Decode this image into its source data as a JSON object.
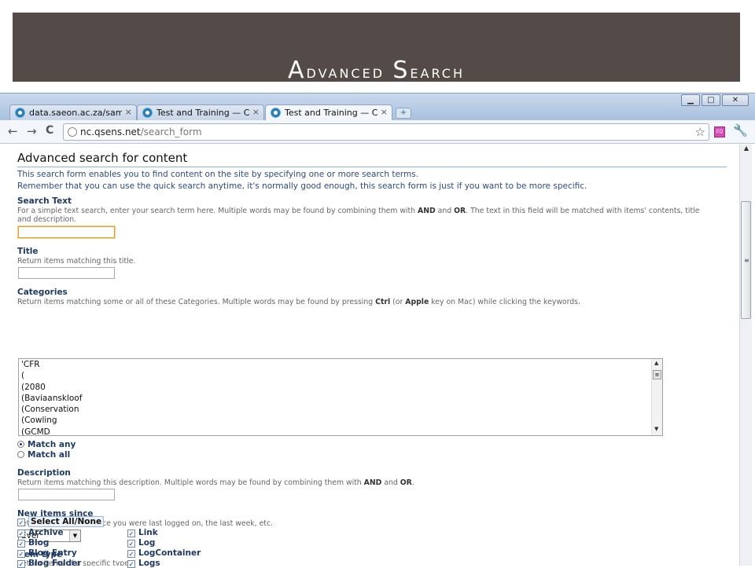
{
  "slide": {
    "title_first": "A",
    "title_rest1": "dvanced ",
    "title_second": "S",
    "title_rest2": "earch"
  },
  "browser": {
    "tabs": [
      {
        "label": "data.saeon.ac.za/sample-...",
        "close": "×"
      },
      {
        "label": "Test and Training — CoGIS",
        "close": "×"
      },
      {
        "label": "Test and Training — CoGIS",
        "close": "×"
      }
    ],
    "new_tab": "+",
    "window_controls": {
      "minimize": "▁",
      "maximize": "□",
      "close": "✕"
    },
    "nav": {
      "back": "←",
      "forward": "→",
      "reload": "C"
    },
    "url_host": "nc.qsens.net",
    "url_path": "/search_form",
    "star": "☆",
    "ext_label": "EQ",
    "wrench": "🔧"
  },
  "page": {
    "title": "Advanced search for content",
    "intro_1": "This search form enables you to find content on the site by specifying one or more search terms.",
    "intro_2": "Remember that you can use the quick search anytime, it's normally good enough, this search form is just if you want to be more specific.",
    "search_text": {
      "label": "Search Text",
      "help_a": "For a simple text search, enter your search term here. Multiple words may be found by combining them with ",
      "help_and": "AND",
      "help_b": " and ",
      "help_or": "OR",
      "help_c": ". The text in this field will be matched with items' contents, title",
      "help_d": "and description.",
      "value": ""
    },
    "title_field": {
      "label": "Title",
      "help": "Return items matching this title.",
      "value": ""
    },
    "categories": {
      "label": "Categories",
      "help_a": "Return items matching some or all of these Categories. Multiple words may be found by pressing ",
      "help_ctrl": "Ctrl",
      "help_b": " (or ",
      "help_apple": "Apple",
      "help_c": " key on Mac) while clicking the keywords.",
      "options": [
        "'CFR",
        "(",
        "(2080",
        "(Baviaanskloof",
        "(Conservation",
        "(Cowling",
        "(GCMD"
      ],
      "match_any": "Match any",
      "match_all": "Match all",
      "selected_match": "any"
    },
    "description": {
      "label": "Description",
      "help_a": "Return items matching this description. Multiple words may be found by combining them with ",
      "help_and": "AND",
      "help_b": " and ",
      "help_or": "OR",
      "help_c": ".",
      "value": ""
    },
    "new_items": {
      "label": "New items since",
      "help": "Return items added since you were last logged on, the last week, etc.",
      "selected": "Ever"
    },
    "item_type": {
      "label": "Item type",
      "help": "Return items of a specific type.",
      "select_all": "Select All/None",
      "col1": [
        "Archive",
        "Blog",
        "Blog Entry",
        "Blog Folder"
      ],
      "col2": [
        "Link",
        "Log",
        "LogContainer",
        "Logs"
      ]
    }
  }
}
